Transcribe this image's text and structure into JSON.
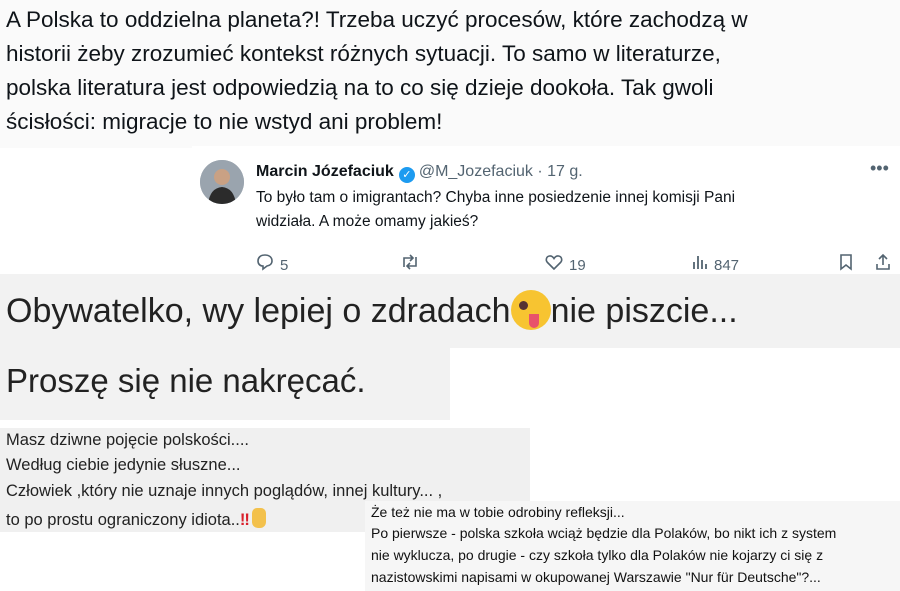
{
  "top_text": {
    "lines": [
      "A Polska to oddzielna planeta?! Trzeba uczyć procesów, które zachodzą w",
      "historii żeby zrozumieć kontekst różnych sytuacji. To samo w literaturze,",
      "polska literatura jest odpowiedzią na to co się dzieje dookoła. Tak gwoli",
      "ścisłości: migracje to nie wstyd ani problem!"
    ]
  },
  "tweet": {
    "name": "Marcin Józefaciuk",
    "handle": "@M_Jozefaciuk",
    "separator": "·",
    "time": "17 g.",
    "more": "•••",
    "body_lines": [
      "To było tam o imigrantach? Chyba inne posiedzenie innej komisji Pani",
      "widziała. A może omamy jakieś?"
    ],
    "actions": {
      "replies": "5",
      "retweets": "",
      "likes": "19",
      "views": "847"
    },
    "accent_color": "#1d9bf0"
  },
  "quote1": {
    "before_emoji": "Obywatelko, wy lepiej o zdradach",
    "after_emoji": "nie piszcie..."
  },
  "quote2": {
    "text": "Proszę się nie nakręcać."
  },
  "comment1": {
    "lines": [
      "Masz dziwne pojęcie polskości....",
      "Według ciebie jedynie słuszne...",
      "Człowiek ,który nie uznaje innych poglądów, innej kultury... ,",
      " to po prostu ograniczony idiota.."
    ],
    "exclamation": "‼"
  },
  "comment2": {
    "lines": [
      "Że też nie ma w tobie odrobiny refleksji...",
      "Po pierwsze - polska szkoła wciąż będzie dla Polaków, bo nikt ich z system",
      "nie wyklucza, po drugie - czy szkoła tylko dla Polaków nie kojarzy ci się z",
      "nazistowskimi napisami w okupowanej Warszawie \"Nur für Deutsche\"?..."
    ]
  }
}
